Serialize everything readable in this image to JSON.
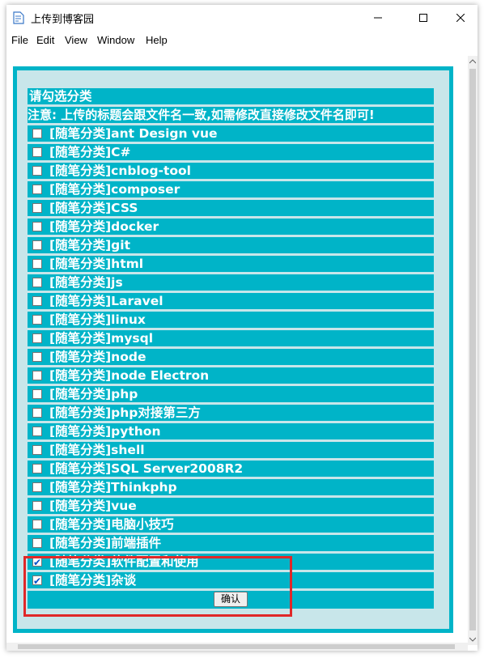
{
  "window": {
    "title": "上传到博客园",
    "icon": "document-edit-icon"
  },
  "menu": [
    "File",
    "Edit",
    "View",
    "Window",
    "Help"
  ],
  "panel": {
    "header": "请勾选分类",
    "notice": "注意: 上传的标题会跟文件名一致,如需修改直接修改文件名即可!",
    "categories": [
      {
        "label": "[随笔分类]ant Design vue",
        "checked": false
      },
      {
        "label": "[随笔分类]C#",
        "checked": false
      },
      {
        "label": "[随笔分类]cnblog-tool",
        "checked": false
      },
      {
        "label": "[随笔分类]composer",
        "checked": false
      },
      {
        "label": "[随笔分类]CSS",
        "checked": false
      },
      {
        "label": "[随笔分类]docker",
        "checked": false
      },
      {
        "label": "[随笔分类]git",
        "checked": false
      },
      {
        "label": "[随笔分类]html",
        "checked": false
      },
      {
        "label": "[随笔分类]js",
        "checked": false
      },
      {
        "label": "[随笔分类]Laravel",
        "checked": false
      },
      {
        "label": "[随笔分类]linux",
        "checked": false
      },
      {
        "label": "[随笔分类]mysql",
        "checked": false
      },
      {
        "label": "[随笔分类]node",
        "checked": false
      },
      {
        "label": "[随笔分类]node Electron",
        "checked": false
      },
      {
        "label": "[随笔分类]php",
        "checked": false
      },
      {
        "label": "[随笔分类]php对接第三方",
        "checked": false
      },
      {
        "label": "[随笔分类]python",
        "checked": false
      },
      {
        "label": "[随笔分类]shell",
        "checked": false
      },
      {
        "label": "[随笔分类]SQL Server2008R2",
        "checked": false
      },
      {
        "label": "[随笔分类]Thinkphp",
        "checked": false
      },
      {
        "label": "[随笔分类]vue",
        "checked": false
      },
      {
        "label": "[随笔分类]电脑小技巧",
        "checked": false
      },
      {
        "label": "[随笔分类]前端插件",
        "checked": false
      },
      {
        "label": "[随笔分类]软件配置和使用",
        "checked": true
      },
      {
        "label": "[随笔分类]杂谈",
        "checked": true
      }
    ],
    "confirm_label": "确认"
  },
  "colors": {
    "accent": "#00b4c8",
    "panel_bg": "#c8e6ea",
    "highlight": "#e02828"
  }
}
